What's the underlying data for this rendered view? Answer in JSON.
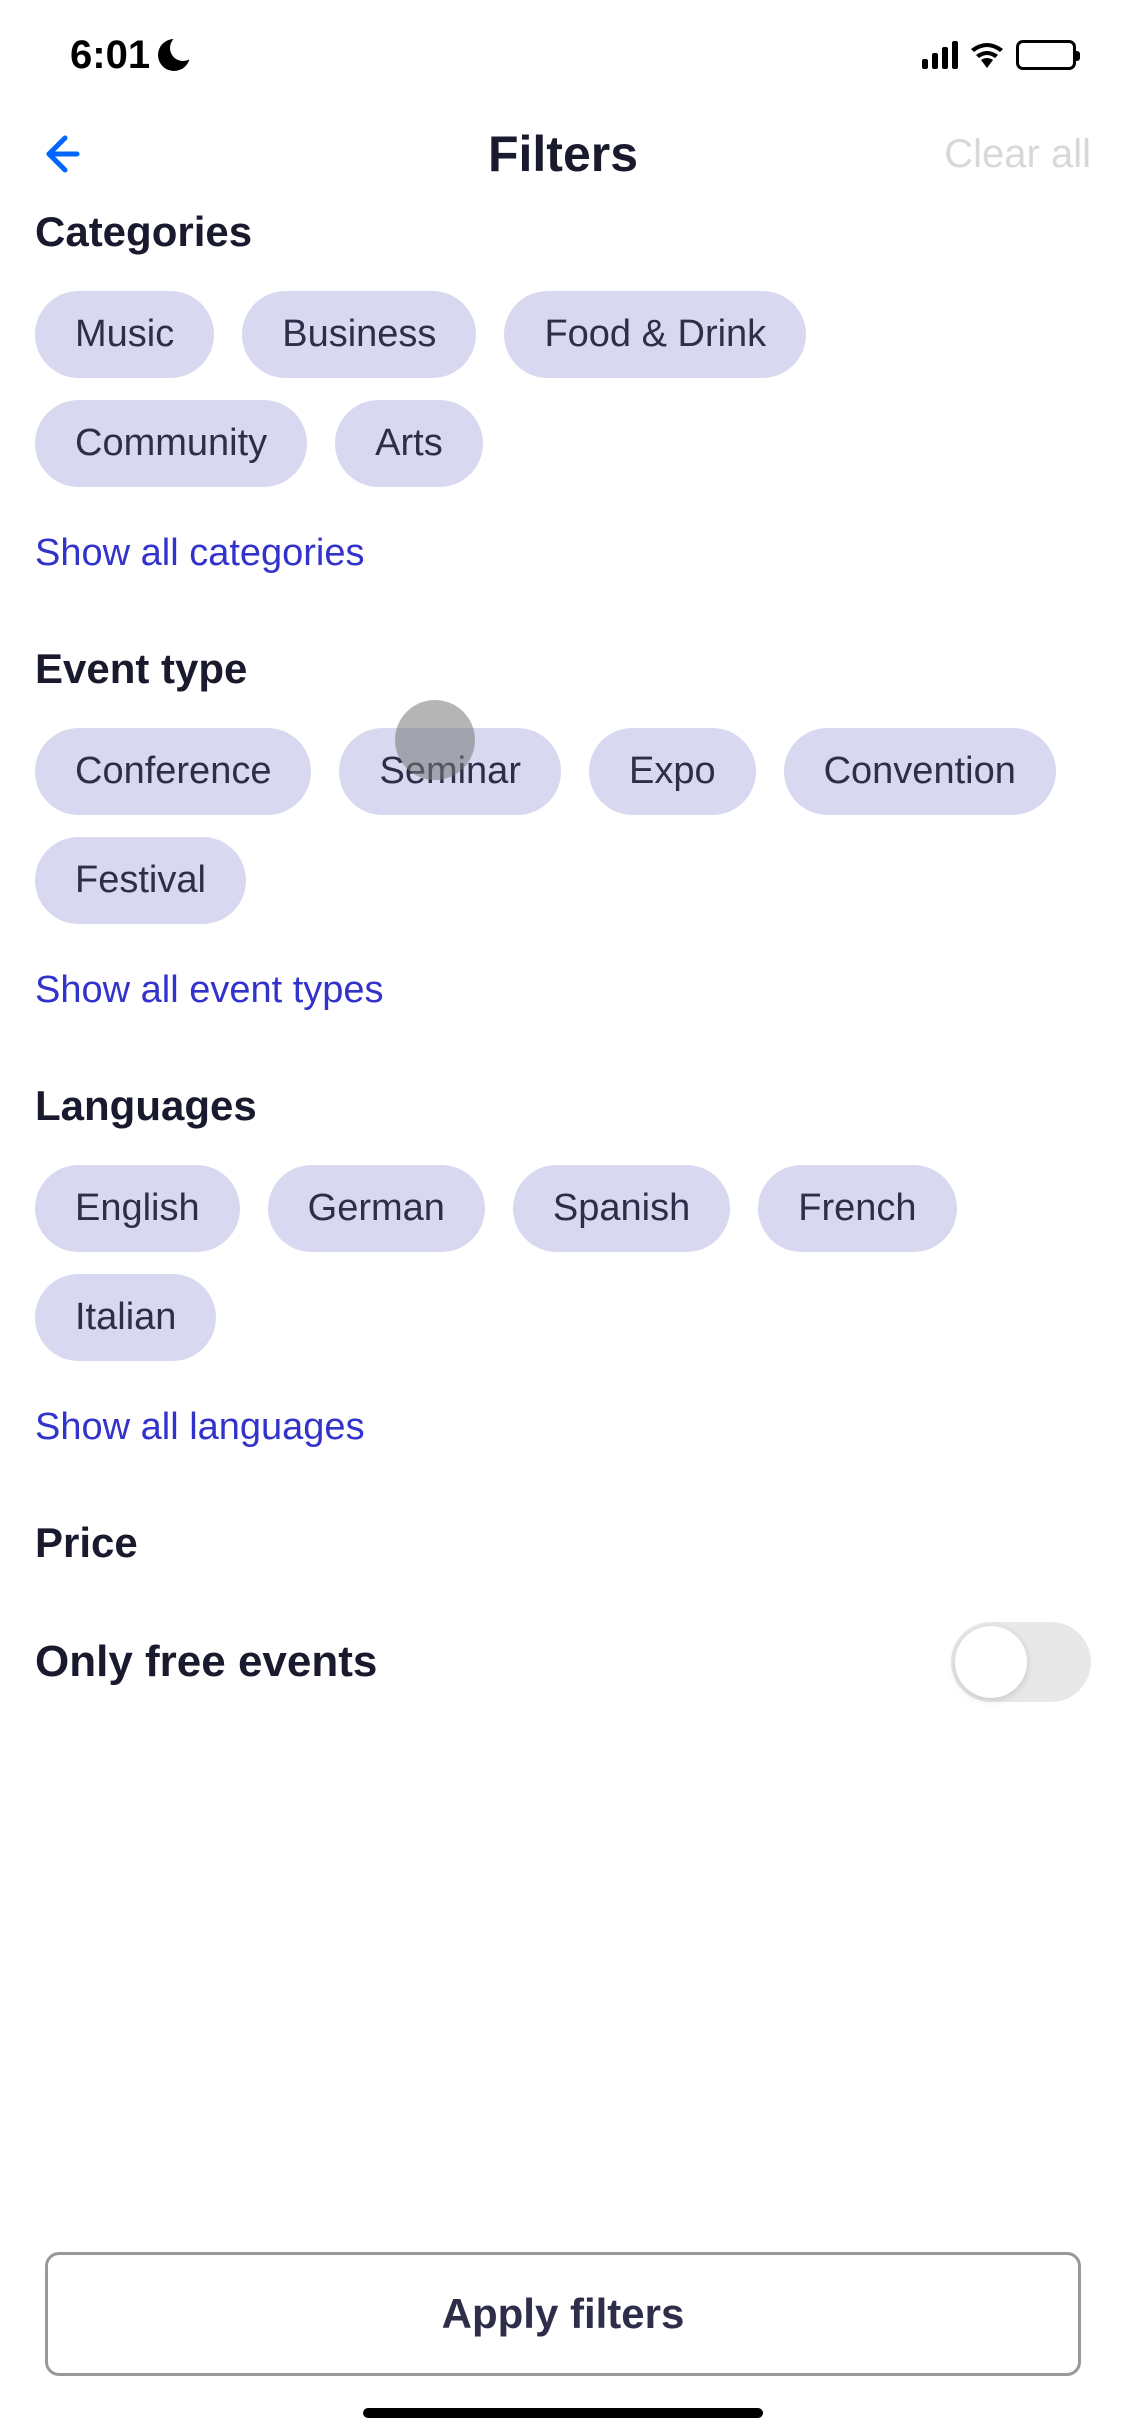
{
  "statusBar": {
    "time": "6:01"
  },
  "header": {
    "title": "Filters",
    "clearAll": "Clear all"
  },
  "sections": {
    "categories": {
      "title": "Categories",
      "chips": [
        "Music",
        "Business",
        "Food & Drink",
        "Community",
        "Arts"
      ],
      "showAll": "Show all categories"
    },
    "eventType": {
      "title": "Event type",
      "chips": [
        "Conference",
        "Seminar",
        "Expo",
        "Convention",
        "Festival"
      ],
      "showAll": "Show all event types"
    },
    "languages": {
      "title": "Languages",
      "chips": [
        "English",
        "German",
        "Spanish",
        "French",
        "Italian"
      ],
      "showAll": "Show all languages"
    },
    "price": {
      "title": "Price",
      "toggleLabel": "Only free events",
      "toggleState": false
    }
  },
  "bottomBar": {
    "apply": "Apply filters"
  }
}
